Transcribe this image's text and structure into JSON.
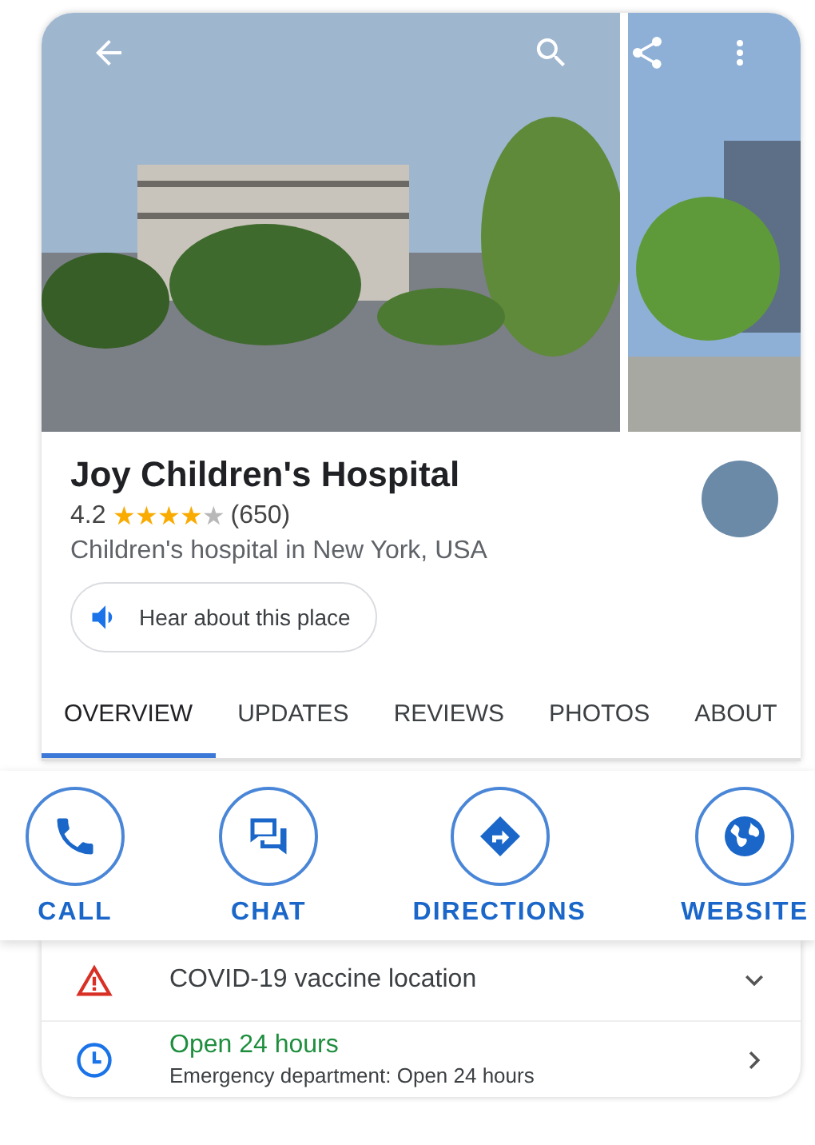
{
  "place": {
    "name": "Joy Children's Hospital",
    "rating": "4.2",
    "stars": 4,
    "review_count": "(650)",
    "category": "Children's hospital in New York, USA",
    "listen_button": "Hear about this place"
  },
  "tabs": [
    {
      "label": "OVERVIEW",
      "selected": true
    },
    {
      "label": "UPDATES",
      "selected": false
    },
    {
      "label": "REVIEWS",
      "selected": false
    },
    {
      "label": "PHOTOS",
      "selected": false
    },
    {
      "label": "ABOUT",
      "selected": false
    }
  ],
  "actions": [
    {
      "kind": "call",
      "label": "CALL"
    },
    {
      "kind": "chat",
      "label": "CHAT"
    },
    {
      "kind": "directions",
      "label": "DIRECTIONS"
    },
    {
      "kind": "website",
      "label": "WEBSITE"
    }
  ],
  "info_rows": [
    {
      "kind": "alert",
      "text": "COVID-19 vaccine location"
    },
    {
      "kind": "hours",
      "status": "Open 24 hours",
      "text": "Emergency department: Open 24 hours"
    }
  ]
}
